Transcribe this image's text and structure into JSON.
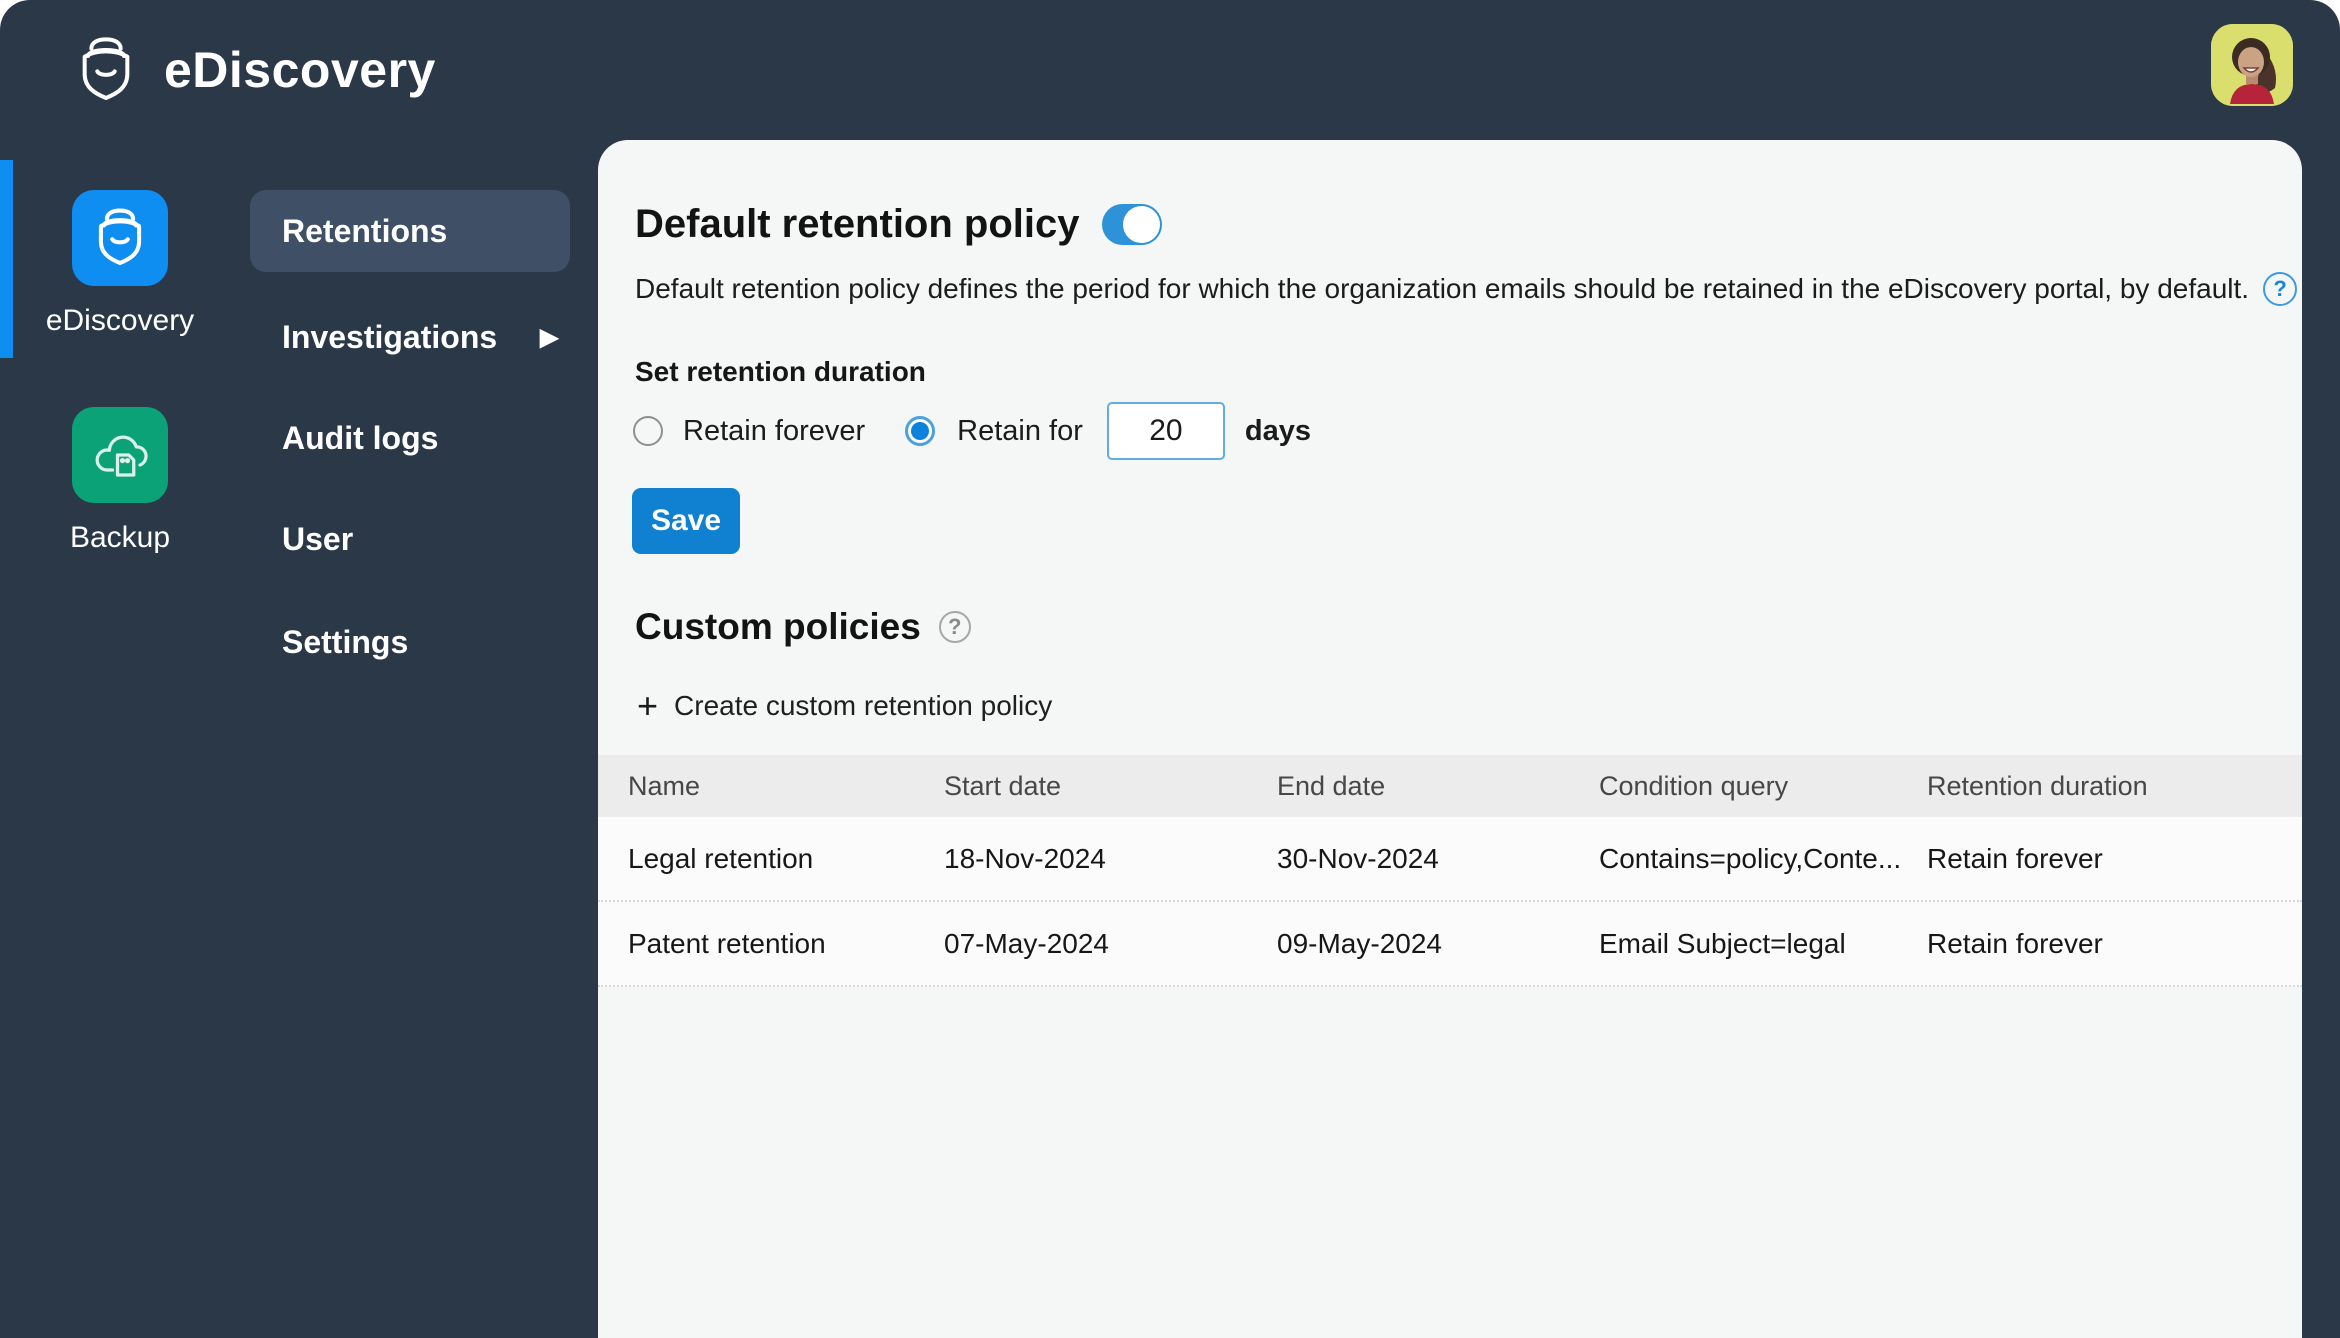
{
  "app": {
    "title": "eDiscovery"
  },
  "colors": {
    "navy_bg": "#2b3848",
    "accent_blue": "#0f8ef2",
    "action_blue": "#0f81d0",
    "toggle_blue": "#2e92d8",
    "green_tile": "#0ca278",
    "selected_menu": "#3f4f65",
    "card_bg": "#f5f6f6",
    "table_header_bg": "#ececec"
  },
  "glyphs": {
    "submenu_arrow": "▶",
    "plus": "+",
    "help": "?"
  },
  "nav": {
    "modules": [
      {
        "label": "eDiscovery",
        "active": true
      },
      {
        "label": "Backup",
        "active": false
      }
    ]
  },
  "menu": {
    "items": [
      {
        "label": "Retentions",
        "selected": true
      },
      {
        "label": "Investigations",
        "has_submenu": true
      },
      {
        "label": "Audit logs"
      },
      {
        "label": "User"
      },
      {
        "label": "Settings"
      }
    ]
  },
  "default_policy": {
    "title": "Default retention policy",
    "toggle_state": "on",
    "description": "Default retention policy defines the period for which the organization emails should be retained in the eDiscovery portal, by default.",
    "duration_label": "Set retention duration",
    "radio_forever_label": "Retain forever",
    "radio_forever_checked": false,
    "radio_for_label": "Retain for",
    "radio_for_checked": true,
    "days_value": "20",
    "days_suffix": "days",
    "save_label": "Save"
  },
  "custom_policies": {
    "title": "Custom policies",
    "create_label": "Create custom retention policy",
    "table": {
      "headers": [
        "Name",
        "Start date",
        "End date",
        "Condition query",
        "Retention duration"
      ],
      "rows": [
        {
          "name": "Legal retention",
          "start": "18-Nov-2024",
          "end": "30-Nov-2024",
          "condition": "Contains=policy,Conte...",
          "duration": "Retain forever"
        },
        {
          "name": "Patent retention",
          "start": "07-May-2024",
          "end": "09-May-2024",
          "condition": "Email Subject=legal",
          "duration": "Retain forever"
        }
      ]
    }
  }
}
